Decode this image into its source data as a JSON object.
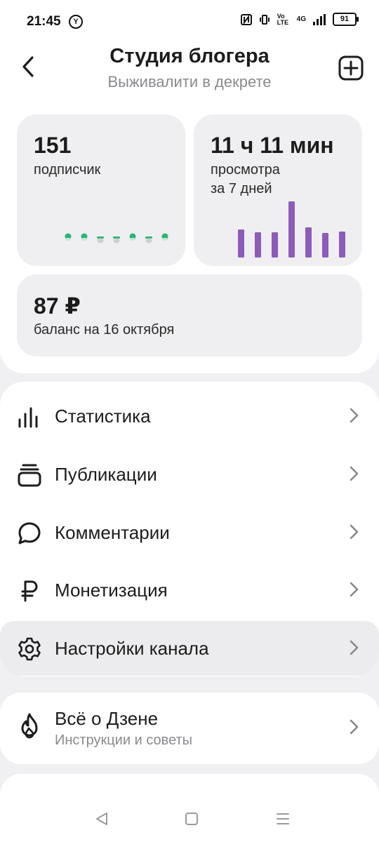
{
  "status_bar": {
    "time": "21:45",
    "y_icon": "Y",
    "volte": "Vo LTE",
    "network": "4G",
    "battery": "91"
  },
  "header": {
    "title": "Студия блогера",
    "subtitle": "Выживалити в декрете"
  },
  "stats": {
    "subscribers": {
      "value": "151",
      "label": "подписчик",
      "trend": [
        0,
        0,
        -1,
        -1,
        0,
        -1,
        0
      ]
    },
    "views": {
      "value": "11 ч 11 мин",
      "label_line1": "просмотра",
      "label_line2": "за 7 дней",
      "bars": [
        40,
        36,
        36,
        80,
        43,
        35,
        37
      ]
    },
    "balance": {
      "value": "87 ₽",
      "label": "баланс на 16 октября"
    }
  },
  "menu": {
    "items": [
      {
        "label": "Статистика",
        "icon": "bar-chart-icon"
      },
      {
        "label": "Публикации",
        "icon": "stack-icon"
      },
      {
        "label": "Комментарии",
        "icon": "comment-icon"
      },
      {
        "label": "Монетизация",
        "icon": "ruble-icon"
      },
      {
        "label": "Настройки канала",
        "icon": "gear-icon"
      }
    ]
  },
  "about": {
    "title": "Всё о Дзене",
    "subtitle": "Инструкции и советы",
    "icon": "flame-icon"
  },
  "nav": {
    "back": "back-icon",
    "home": "home-icon",
    "recents": "recents-icon"
  },
  "colors": {
    "green": "#2bb673",
    "purple": "#8c5cb8",
    "card_bg": "#efeff1",
    "page_bg": "#f0f0f2"
  }
}
